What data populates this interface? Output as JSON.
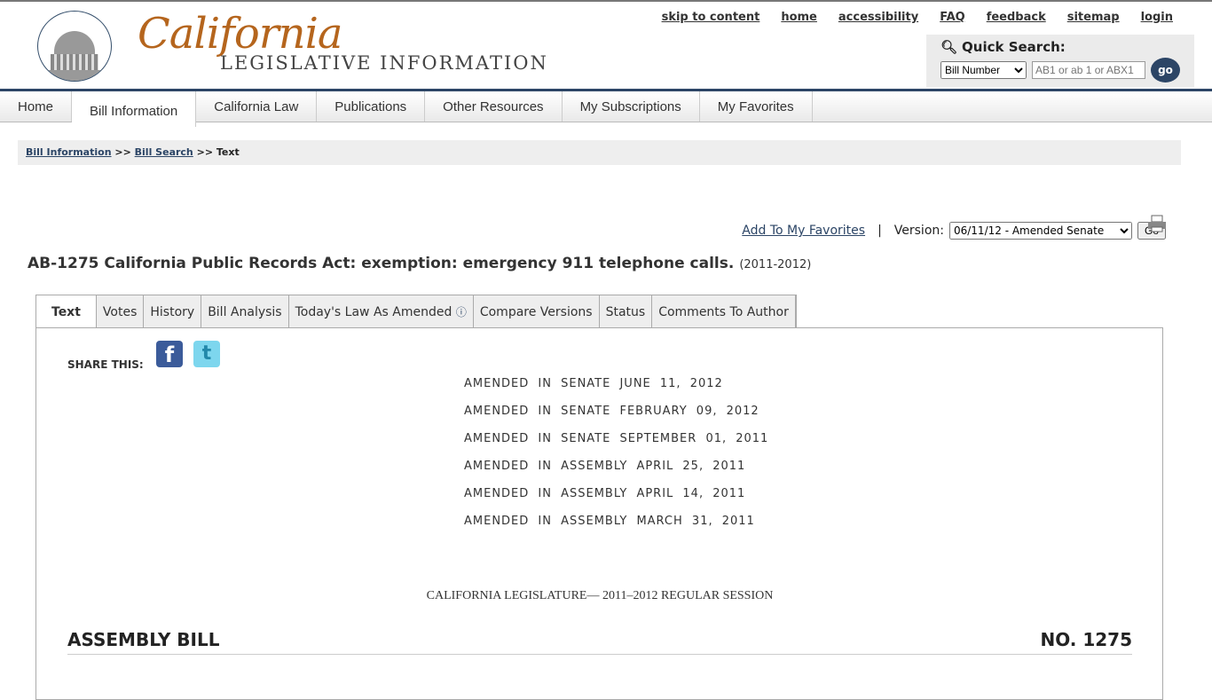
{
  "logo": {
    "script": "California",
    "sub": "LEGISLATIVE INFORMATION"
  },
  "top_links": [
    "skip to content",
    "home",
    "accessibility",
    "FAQ",
    "feedback",
    "sitemap",
    "login"
  ],
  "quick_search": {
    "title": "Quick Search:",
    "select": "Bill Number",
    "placeholder": "AB1 or ab 1 or ABX1",
    "go": "go"
  },
  "nav": [
    "Home",
    "Bill Information",
    "California Law",
    "Publications",
    "Other Resources",
    "My Subscriptions",
    "My Favorites"
  ],
  "breadcrumb": {
    "a": "Bill Information",
    "sep": ">>",
    "b": "Bill Search",
    "c": "Text"
  },
  "version": {
    "favorites": "Add To My Favorites",
    "sep": "|",
    "label": "Version:",
    "selected": "06/11/12 - Amended Senate",
    "go": "Go"
  },
  "bill": {
    "title": "AB-1275 California Public Records Act: exemption: emergency 911 telephone calls.",
    "session": "(2011-2012)"
  },
  "tabs": [
    "Text",
    "Votes",
    "History",
    "Bill Analysis",
    "Today's Law As Amended",
    "Compare Versions",
    "Status",
    "Comments To Author"
  ],
  "share": "SHARE THIS:",
  "amendments": [
    "AMENDED IN SENATE JUNE 11, 2012",
    "AMENDED IN SENATE FEBRUARY 09, 2012",
    "AMENDED IN SENATE SEPTEMBER 01, 2011",
    "AMENDED IN ASSEMBLY APRIL 25, 2011",
    "AMENDED IN ASSEMBLY APRIL 14, 2011",
    "AMENDED IN ASSEMBLY MARCH 31, 2011"
  ],
  "session_line": "CALIFORNIA LEGISLATURE— 2011–2012 REGULAR SESSION",
  "bill_type": "ASSEMBLY BILL",
  "bill_no": "NO. 1275"
}
